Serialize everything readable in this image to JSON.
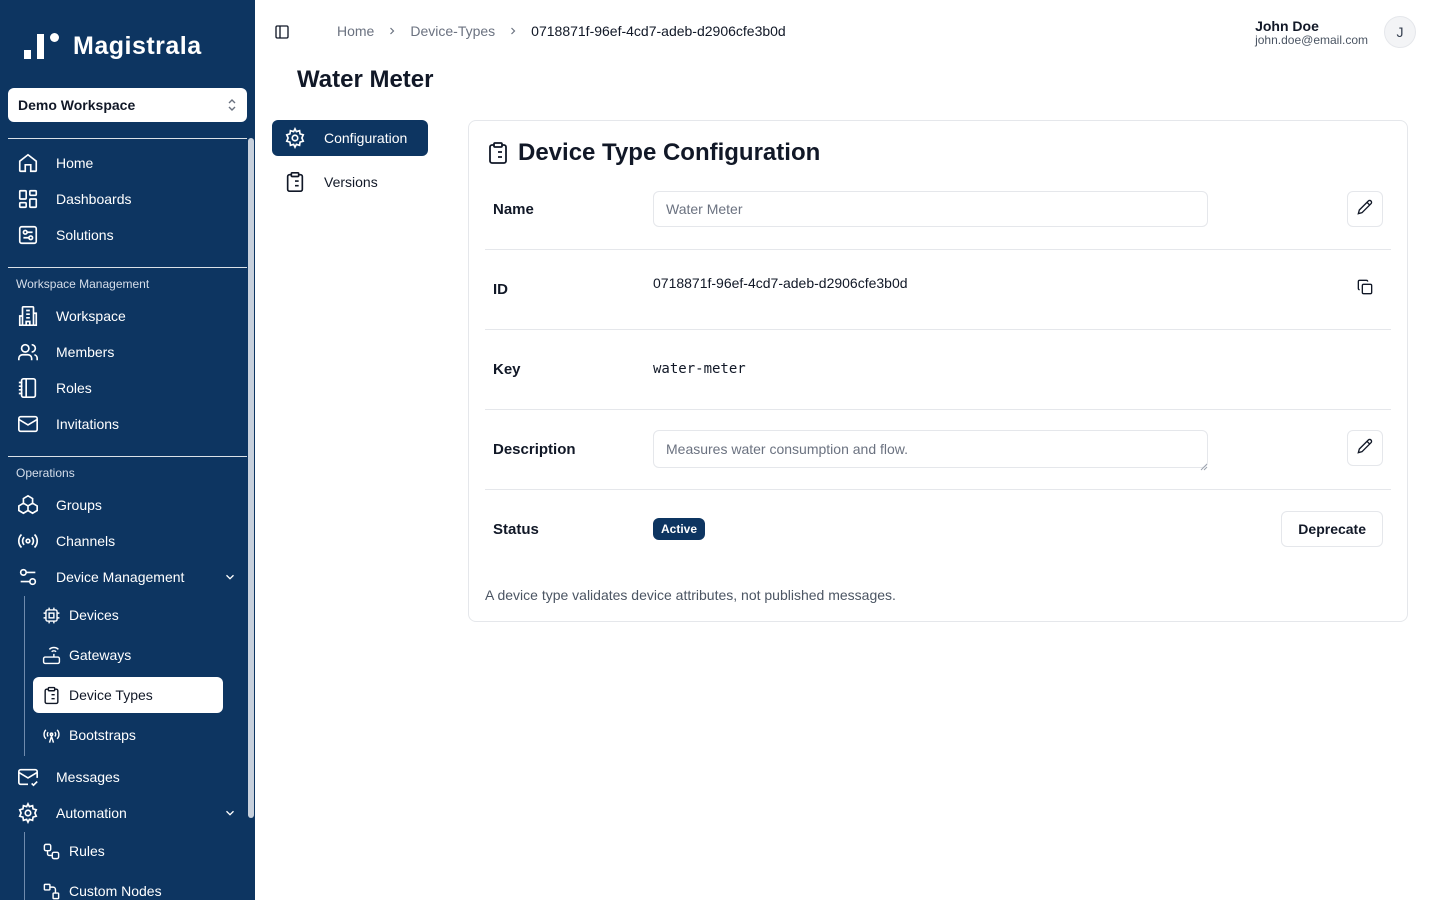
{
  "app": {
    "name": "Magistrala"
  },
  "workspace": {
    "selected": "Demo Workspace"
  },
  "sidebar": {
    "main": [
      {
        "label": "Home",
        "icon": "home-icon"
      },
      {
        "label": "Dashboards",
        "icon": "dashboard-icon"
      },
      {
        "label": "Solutions",
        "icon": "solutions-icon"
      }
    ],
    "workspace_management": {
      "title": "Workspace Management",
      "items": [
        {
          "label": "Workspace",
          "icon": "building-icon"
        },
        {
          "label": "Members",
          "icon": "users-icon"
        },
        {
          "label": "Roles",
          "icon": "notebook-icon"
        },
        {
          "label": "Invitations",
          "icon": "mail-icon"
        }
      ]
    },
    "operations": {
      "title": "Operations",
      "items": [
        {
          "label": "Groups",
          "icon": "boxes-icon"
        },
        {
          "label": "Channels",
          "icon": "radio-icon"
        },
        {
          "label": "Device Management",
          "icon": "settings-sliders-icon"
        }
      ],
      "device_management_items": [
        {
          "label": "Devices",
          "icon": "cpu-icon"
        },
        {
          "label": "Gateways",
          "icon": "router-icon"
        },
        {
          "label": "Device Types",
          "icon": "clipboard-icon"
        },
        {
          "label": "Bootstraps",
          "icon": "antenna-icon"
        }
      ],
      "more_items": [
        {
          "label": "Messages",
          "icon": "mail-open-icon"
        },
        {
          "label": "Automation",
          "icon": "gear-icon"
        }
      ],
      "automation_items": [
        {
          "label": "Rules",
          "icon": "workflow-icon"
        },
        {
          "label": "Custom Nodes",
          "icon": "nodes-icon"
        }
      ]
    }
  },
  "breadcrumb": [
    "Home",
    "Device-Types",
    "0718871f-96ef-4cd7-adeb-d2906cfe3b0d"
  ],
  "user": {
    "name": "John Doe",
    "email": "john.doe@email.com",
    "initial": "J"
  },
  "page": {
    "title": "Water Meter"
  },
  "tabs": [
    {
      "label": "Configuration",
      "icon": "gear-icon",
      "active": true
    },
    {
      "label": "Versions",
      "icon": "clipboard-icon",
      "active": false
    }
  ],
  "card": {
    "title": "Device Type Configuration",
    "name_label": "Name",
    "name_value": "Water Meter",
    "id_label": "ID",
    "id_value": "0718871f-96ef-4cd7-adeb-d2906cfe3b0d",
    "key_label": "Key",
    "key_value": "water-meter",
    "description_label": "Description",
    "description_value": "Measures water consumption and flow.",
    "status_label": "Status",
    "status_value": "Active",
    "deprecate_label": "Deprecate",
    "note": "A device type validates device attributes, not published messages."
  },
  "colors": {
    "sidebar": "#0d3561",
    "accent": "#0d3561"
  }
}
